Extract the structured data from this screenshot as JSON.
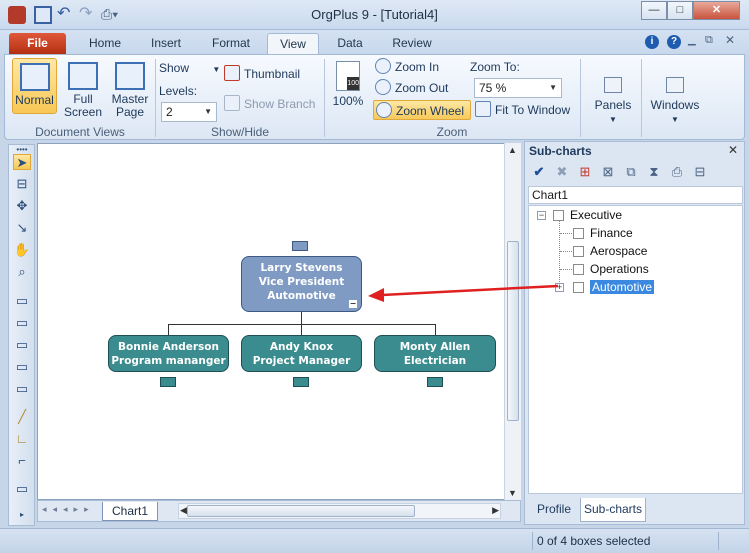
{
  "window": {
    "title": "OrgPlus 9 - [Tutorial4]",
    "controls": {
      "minimize": "—",
      "maximize": "□",
      "close": "✕"
    }
  },
  "ribbon_tabs": [
    "File",
    "Home",
    "Insert",
    "Format",
    "View",
    "Data",
    "Review"
  ],
  "ribbon": {
    "document_views": {
      "label": "Document Views",
      "normal": "Normal",
      "full_screen": [
        "Full",
        "Screen"
      ],
      "master_page": [
        "Master",
        "Page"
      ]
    },
    "show_hide": {
      "label": "Show/Hide",
      "show": "Show",
      "levels_label": "Levels:",
      "levels_value": "2",
      "thumbnail": "Thumbnail",
      "show_branch": "Show Branch"
    },
    "zoom": {
      "label": "Zoom",
      "percent": "100%",
      "zoom_in": "Zoom In",
      "zoom_out": "Zoom Out",
      "zoom_wheel": "Zoom Wheel",
      "zoom_to_label": "Zoom To:",
      "zoom_to_value": "75 %",
      "fit_to_window": "Fit To Window"
    },
    "panels": "Panels",
    "windows": "Windows"
  },
  "orgchart": {
    "root": [
      "Larry  Stevens",
      "Vice President",
      "Automotive"
    ],
    "children": [
      [
        "Bonnie  Anderson",
        "Program mananger"
      ],
      [
        "Andy  Knox",
        "Project Manager"
      ],
      [
        "Monty  Allen",
        "Electrician"
      ]
    ]
  },
  "sheet_tab": "Chart1",
  "subcharts_panel": {
    "title": "Sub-charts",
    "chart_label": "Chart1",
    "tree": {
      "root": "Executive",
      "children": [
        "Finance",
        "Aerospace",
        "Operations",
        "Automotive"
      ],
      "selected": "Automotive"
    },
    "tabs": [
      "Profile",
      "Sub-charts"
    ]
  },
  "status": {
    "text": "0 of 4 boxes selected"
  },
  "colors": {
    "accent_file_tab": "#c23a1c",
    "selected_tool": "#f8c754",
    "node_teal": "#3a8c8e",
    "node_root": "#7f9bc4",
    "annotation_arrow": "#e02020"
  }
}
